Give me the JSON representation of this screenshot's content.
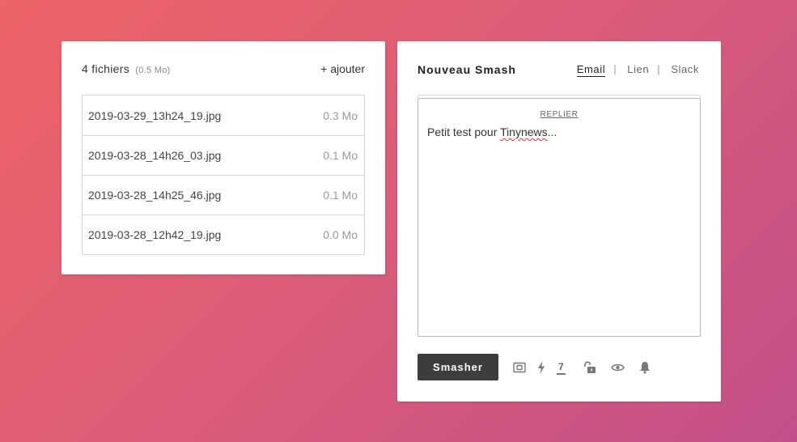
{
  "files": {
    "count_label": "4 fichiers",
    "total_size": "(0.5 Mo)",
    "add_label": "+ ajouter",
    "items": [
      {
        "name": "2019-03-29_13h24_19.jpg",
        "size": "0.3 Mo"
      },
      {
        "name": "2019-03-28_14h26_03.jpg",
        "size": "0.1 Mo"
      },
      {
        "name": "2019-03-28_14h25_46.jpg",
        "size": "0.1 Mo"
      },
      {
        "name": "2019-03-28_12h42_19.jpg",
        "size": "0.0 Mo"
      }
    ]
  },
  "compose": {
    "title": "Nouveau Smash",
    "tabs": [
      {
        "label": "Email",
        "active": true
      },
      {
        "label": "Lien",
        "active": false
      },
      {
        "label": "Slack",
        "active": false
      }
    ],
    "tab_separator": "|",
    "replier_label": "REPLIER",
    "message_prefix": "Petit test pour ",
    "message_misspelled": "Tinynews",
    "message_suffix": "...",
    "smash_label": "Smasher",
    "expiry_days": "7"
  },
  "icons": {
    "preview": "photo-frame-icon",
    "flash": "lightning-icon",
    "lock": "unlock-icon",
    "view": "eye-icon",
    "notify": "bell-icon"
  },
  "colors": {
    "background_start": "#ed6366",
    "background_end": "#c44f8a",
    "button": "#3d3d3d",
    "spellcheck": "#e03030"
  }
}
